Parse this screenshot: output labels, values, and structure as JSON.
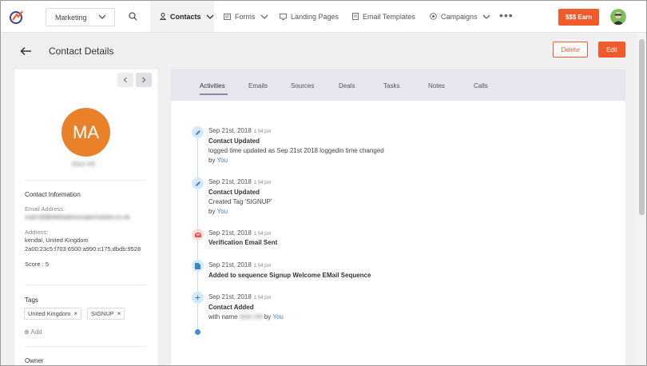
{
  "nav": {
    "dropdown_label": "Marketing",
    "items": [
      {
        "label": "Contacts",
        "icon": "person-icon",
        "active": true
      },
      {
        "label": "Forms",
        "icon": "form-icon"
      },
      {
        "label": "Landing Pages",
        "icon": "monitor-icon"
      },
      {
        "label": "Email Templates",
        "icon": "document-icon"
      },
      {
        "label": "Campaigns",
        "icon": "target-icon"
      }
    ],
    "earn_label": "$$$ Earn"
  },
  "header": {
    "title": "Contact Details",
    "delete_label": "Delete",
    "edit_label": "Edit"
  },
  "contact": {
    "initials": "MA",
    "name": "Matt Hill",
    "section_title": "Contact Information",
    "email_label": "Email Address:",
    "email": "matt.hill@debtadvicesupermarket.co.uk",
    "address_label": "Address:",
    "address_line1": "kendal, United Kingdom",
    "address_line2": "2a00:23c5:f703:6500:a990:c175:dbdb:9528",
    "score_text": "Score : 5",
    "tags_title": "Tags",
    "tags": [
      "United Kingdom",
      "SIGNUP"
    ],
    "add_label": "Add",
    "owner_title": "Owner"
  },
  "tabs": [
    "Activities",
    "Emails",
    "Sources",
    "Deals",
    "Tasks",
    "Notes",
    "Calls"
  ],
  "activities": [
    {
      "date": "Sep 21st, 2018",
      "time": "1:04 pm",
      "title": "Contact Updated",
      "desc": "logged time updated as Sep 21st 2018 loggedin time changed",
      "by_prefix": "by",
      "by": "You",
      "icon": "pencil-icon"
    },
    {
      "date": "Sep 21st, 2018",
      "time": "1:04 pm",
      "title": "Contact Updated",
      "desc": "Created Tag 'SIGNUP'",
      "by_prefix": "by",
      "by": "You",
      "icon": "pencil-icon"
    },
    {
      "date": "Sep 21st, 2018",
      "time": "1:04 pm",
      "title": "Verification Email Sent",
      "icon": "envelope-icon"
    },
    {
      "date": "Sep 21st, 2018",
      "time": "1:04 pm",
      "title": "Added to sequence Signup Welcome EMail Sequence",
      "icon": "file-icon"
    },
    {
      "date": "Sep 21st, 2018",
      "time": "1:04 pm",
      "title": "Contact Added",
      "desc_prefix": "with name",
      "desc_name": "Matt Hill",
      "desc_mid": "by",
      "by": "You",
      "icon": "plus-icon"
    }
  ],
  "colors": {
    "accent": "#f15a2b",
    "avatar": "#e8812a",
    "link": "#3a86c8",
    "timeline": "#c7dff4"
  }
}
